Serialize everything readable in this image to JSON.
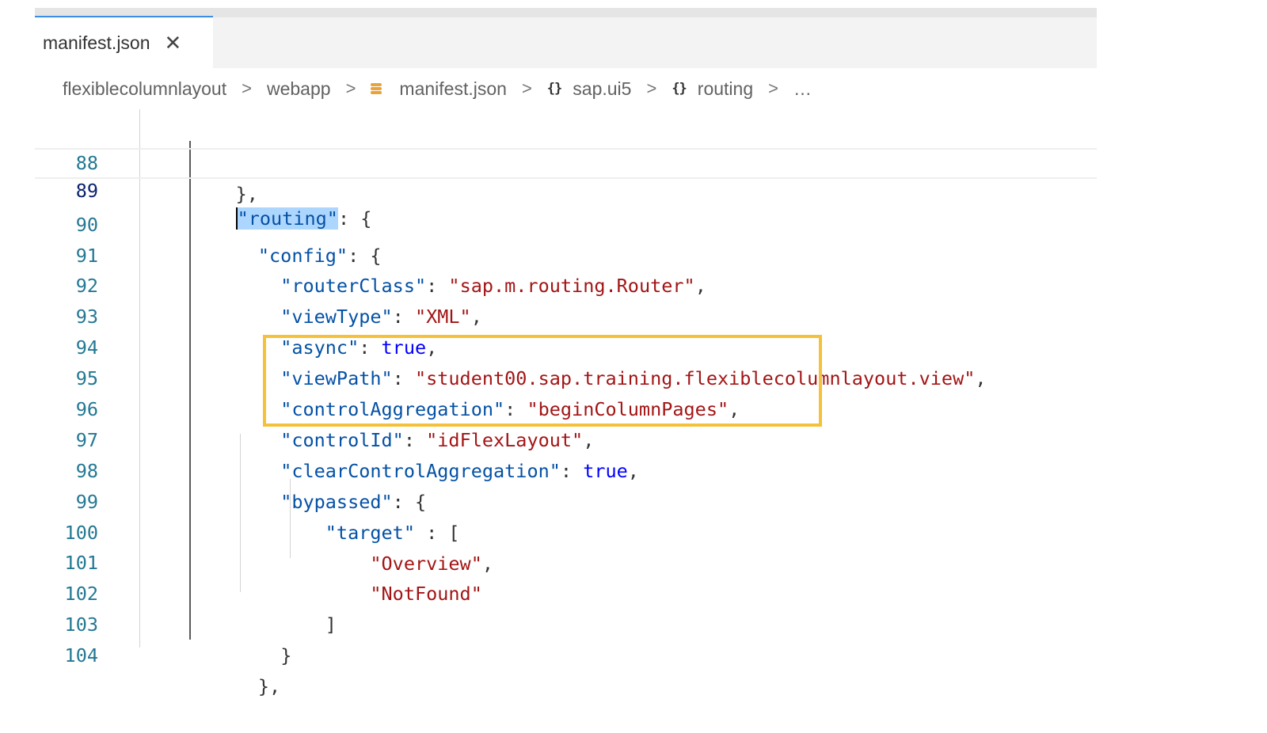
{
  "tab": {
    "label": "manifest.json",
    "close": "✕"
  },
  "breadcrumb": {
    "items": [
      "flexiblecolumnlayout",
      "webapp",
      "manifest.json",
      "sap.ui5",
      "routing",
      "…"
    ],
    "separator": ">",
    "icons": [
      "json-file-icon",
      "object-braces-icon"
    ]
  },
  "lines": [
    {
      "n": "88",
      "indent": "    ",
      "text": "},"
    },
    {
      "n": "89",
      "indent": "    ",
      "key": "\"routing\"",
      "rest": ": {"
    },
    {
      "n": "90",
      "indent": "      ",
      "key": "\"config\"",
      "rest": ": {"
    },
    {
      "n": "91",
      "indent": "        ",
      "key": "\"routerClass\"",
      "sep": ": ",
      "str": "\"sap.m.routing.Router\"",
      "tail": ","
    },
    {
      "n": "92",
      "indent": "        ",
      "key": "\"viewType\"",
      "sep": ": ",
      "str": "\"XML\"",
      "tail": ","
    },
    {
      "n": "93",
      "indent": "        ",
      "key": "\"async\"",
      "sep": ": ",
      "bool": "true",
      "tail": ","
    },
    {
      "n": "94",
      "indent": "        ",
      "key": "\"viewPath\"",
      "sep": ": ",
      "str": "\"student00.sap.training.flexiblecolumnlayout.view\"",
      "tail": ","
    },
    {
      "n": "95",
      "indent": "        ",
      "key": "\"controlAggregation\"",
      "sep": ": ",
      "str": "\"beginColumnPages\"",
      "tail": ","
    },
    {
      "n": "96",
      "indent": "        ",
      "key": "\"controlId\"",
      "sep": ": ",
      "str": "\"idFlexLayout\"",
      "tail": ","
    },
    {
      "n": "97",
      "indent": "        ",
      "key": "\"clearControlAggregation\"",
      "sep": ": ",
      "bool": "true",
      "tail": ","
    },
    {
      "n": "98",
      "indent": "        ",
      "key": "\"bypassed\"",
      "rest": ": {"
    },
    {
      "n": "99",
      "indent": "            ",
      "key": "\"target\"",
      "rest": " : ["
    },
    {
      "n": "100",
      "indent": "                ",
      "str": "\"Overview\"",
      "tail": ","
    },
    {
      "n": "101",
      "indent": "                ",
      "str": "\"NotFound\""
    },
    {
      "n": "102",
      "indent": "            ",
      "text": "]"
    },
    {
      "n": "103",
      "indent": "        ",
      "text": "}"
    },
    {
      "n": "104",
      "indent": "      ",
      "text": "},"
    }
  ],
  "colors": {
    "key": "#0451a5",
    "string": "#a31515",
    "boolean": "#0000ff",
    "line_number": "#237893",
    "callout": "#f5c13b",
    "selection": "#add6ff"
  }
}
